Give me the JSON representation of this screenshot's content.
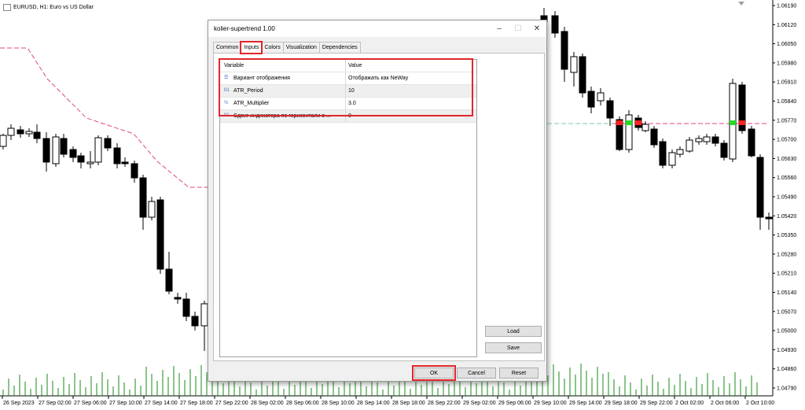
{
  "chart": {
    "symbol_title": "EURUSD, H1:  Euro vs US Dollar",
    "price_ticks": [
      "1.06190",
      "1.06120",
      "1.06050",
      "1.05980",
      "1.05910",
      "1.05840",
      "1.05770",
      "1.05700",
      "1.05630",
      "1.05560",
      "1.05490",
      "1.05420",
      "1.05350",
      "1.05280",
      "1.05210",
      "1.05140",
      "1.05070",
      "1.05000",
      "1.04930",
      "1.04860",
      "1.04790"
    ],
    "time_ticks": [
      "26 Sep 2023",
      "27 Sep 02:00",
      "27 Sep 06:00",
      "27 Sep 10:00",
      "27 Sep 14:00",
      "27 Sep 18:00",
      "27 Sep 22:00",
      "28 Sep 02:00",
      "28 Sep 06:00",
      "28 Sep 10:00",
      "28 Sep 14:00",
      "28 Sep 18:00",
      "28 Sep 22:00",
      "29 Sep 02:00",
      "29 Sep 06:00",
      "29 Sep 10:00",
      "29 Sep 14:00",
      "29 Sep 18:00",
      "29 Sep 22:00",
      "2 Oct 02:00",
      "2 Oct 06:00",
      "2 Oct 10:00"
    ],
    "colors": {
      "bull": "#ffffff",
      "bear": "#000000",
      "supertrend": "#e0468a",
      "volume": "#1a8a1a",
      "signal_red": "#ff2020",
      "signal_green": "#22dd22"
    }
  },
  "dialog": {
    "title": "kolier-supertrend 1.00",
    "window_controls": {
      "minimize": "–",
      "maximize": "☐",
      "close": "✕"
    },
    "tabs": [
      "Common",
      "Inputs",
      "Colors",
      "Visualization",
      "Dependencies"
    ],
    "active_tab": "Inputs",
    "table": {
      "headers": {
        "variable": "Variable",
        "value": "Value"
      },
      "rows": [
        {
          "icon": "list-icon",
          "icon_glyph": "☰",
          "variable": "Вариант отображения",
          "value": "Отображать как NeWay"
        },
        {
          "icon": "integer-icon",
          "icon_glyph": "01",
          "variable": "ATR_Period",
          "value": "10"
        },
        {
          "icon": "double-icon",
          "icon_glyph": "½",
          "variable": "ATR_Multiplier",
          "value": "3.0"
        },
        {
          "icon": "integer-icon",
          "icon_glyph": "01",
          "variable": "Сдвиг индикатора по горизонтали в ...",
          "value": "0"
        }
      ]
    },
    "side_buttons": {
      "load": "Load",
      "save": "Save"
    },
    "footer_buttons": {
      "ok": "OK",
      "cancel": "Cancel",
      "reset": "Reset"
    }
  }
}
